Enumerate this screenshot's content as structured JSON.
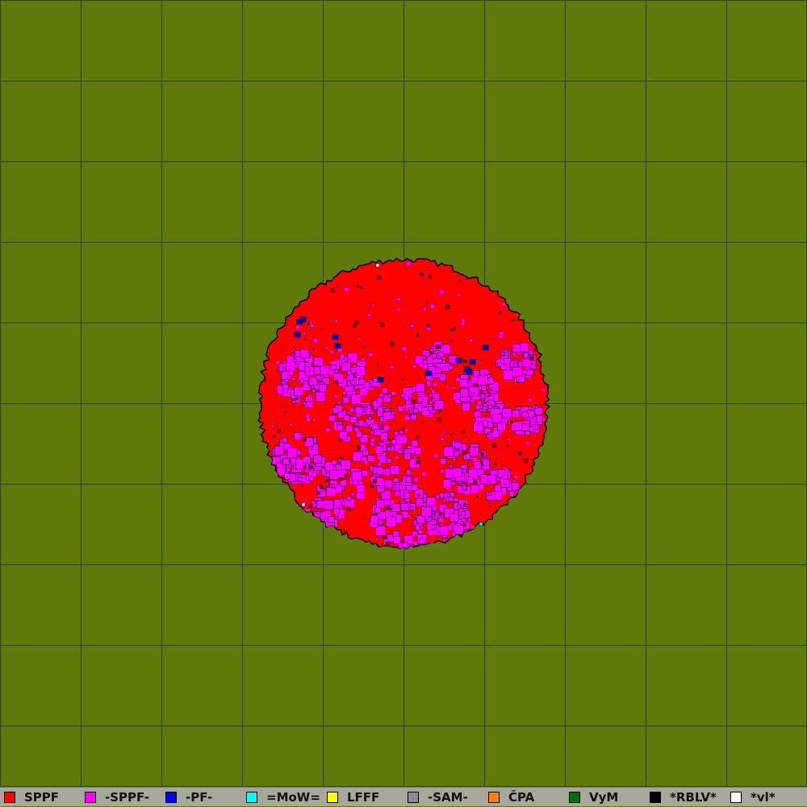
{
  "board": {
    "background_color": "#5f7a0b",
    "grid_color": "#2d4a12",
    "grid_columns": 10,
    "grid_rows": 10
  },
  "territory": {
    "base_color": "#ff0000",
    "patch_color": "#ff00ff",
    "unit_color": "#0000cc",
    "outline_color": "#000000"
  },
  "legend": {
    "items": [
      {
        "label": "SPPF",
        "color": "#ff0000"
      },
      {
        "label": "-SPPF-",
        "color": "#ff00ff"
      },
      {
        "label": "-PF-",
        "color": "#0000ff"
      },
      {
        "label": "=MoW=",
        "color": "#00ffff"
      },
      {
        "label": "LFFF",
        "color": "#ffff00"
      },
      {
        "label": "-SAM-",
        "color": "#8c8c8c"
      },
      {
        "label": "ČPA",
        "color": "#ff8000"
      },
      {
        "label": "VyM",
        "color": "#007000"
      },
      {
        "label": "*RBLV*",
        "color": "#000000"
      },
      {
        "label": "*vl*",
        "color": "#ffffff"
      }
    ]
  }
}
